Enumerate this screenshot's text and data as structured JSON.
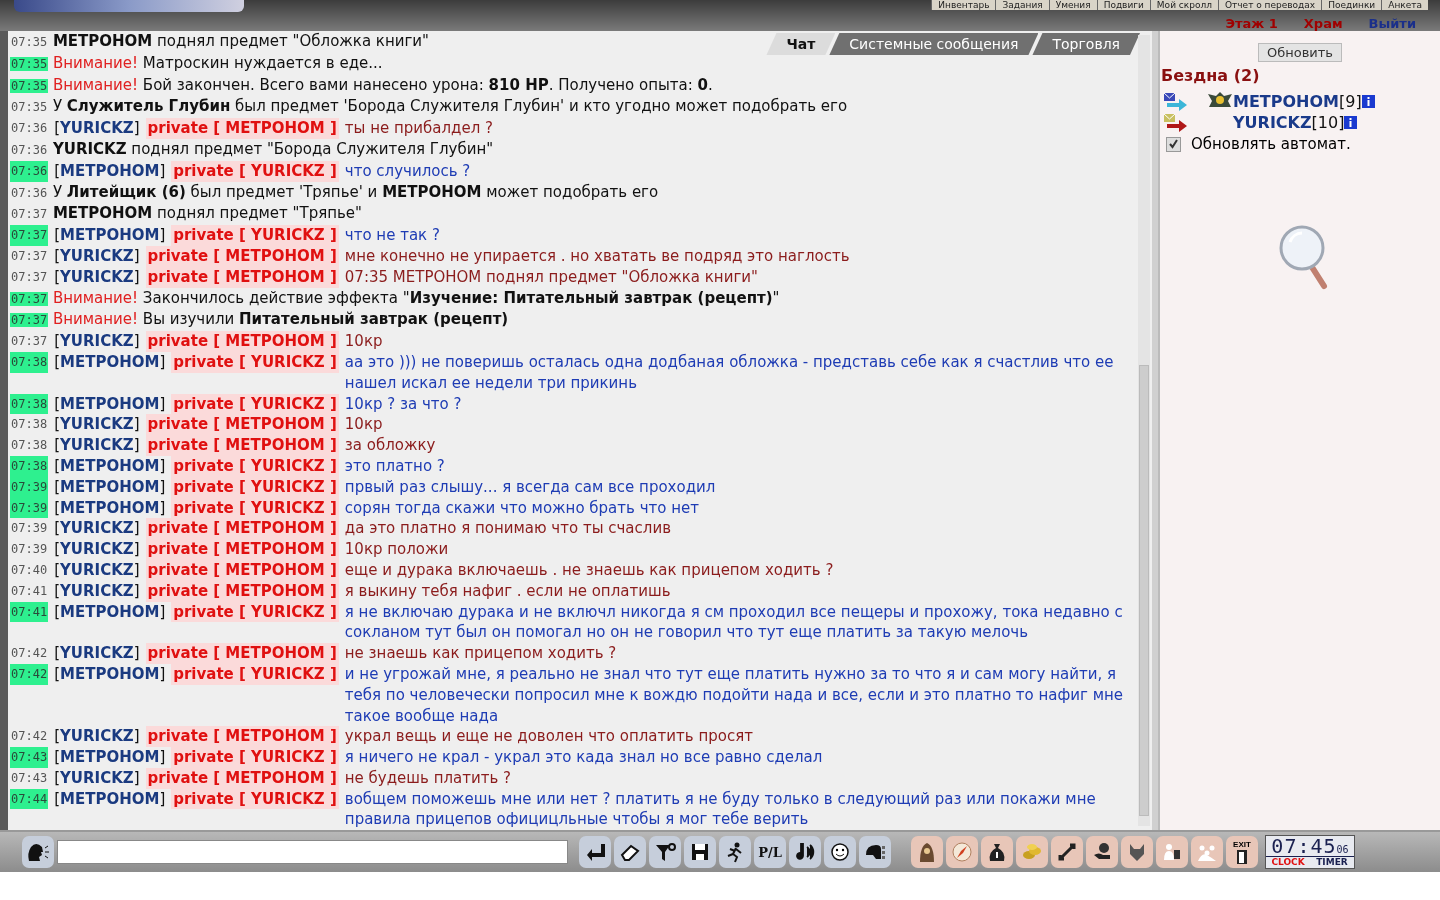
{
  "header": {
    "nav": [
      "Инвентарь",
      "Задания",
      "Умения",
      "Подвиги",
      "Мой скролл",
      "Отчет о переводах",
      "Поединки",
      "Анкета"
    ],
    "location": [
      {
        "text": "Этаж 1",
        "kind": "floor"
      },
      {
        "text": "Храм",
        "kind": "place"
      },
      {
        "text": "Выйти",
        "kind": "exit"
      }
    ]
  },
  "tabs": [
    {
      "label": "Чат",
      "selected": true
    },
    {
      "label": "Системные сообщения",
      "selected": false
    },
    {
      "label": "Торговля",
      "selected": false
    }
  ],
  "messages": [
    {
      "time": "07:35",
      "highlighted": false,
      "kind": "system",
      "text": "**МЕТРОНОМ** поднял предмет \"Обложка книги\""
    },
    {
      "time": "07:35",
      "highlighted": true,
      "kind": "warning",
      "label": "Внимание!",
      "text": "Матроскин нуждается в еде..."
    },
    {
      "time": "07:35",
      "highlighted": true,
      "kind": "warning",
      "label": "Внимание!",
      "text": "Бой закончен. Всего вами нанесено урона: **810 HP**. Получено опыта: **0**."
    },
    {
      "time": "07:35",
      "highlighted": false,
      "kind": "system",
      "text": "У **Служитель Глубин** был предмет 'Борода Служителя Глубин' и кто угодно может подобрать его"
    },
    {
      "time": "07:36",
      "highlighted": false,
      "kind": "private_in",
      "sender": "[**YURICKZ**]",
      "tag": "private [ МЕТРОНОМ ]",
      "text": "ты не прибалдел ?"
    },
    {
      "time": "07:36",
      "highlighted": false,
      "kind": "system",
      "text": "**YURICKZ** поднял предмет \"Борода Служителя Глубин\""
    },
    {
      "time": "07:36",
      "highlighted": true,
      "kind": "private_out",
      "sender": "[**МЕТРОНОМ**]",
      "tag": "private [ YURICKZ ]",
      "text": "что случилось ?"
    },
    {
      "time": "07:36",
      "highlighted": false,
      "kind": "system",
      "text": "У **Литейщик (6)** был предмет 'Тряпье' и **МЕТРОНОМ** может подобрать его"
    },
    {
      "time": "07:37",
      "highlighted": false,
      "kind": "system",
      "text": "**МЕТРОНОМ** поднял предмет \"Тряпье\""
    },
    {
      "time": "07:37",
      "highlighted": true,
      "kind": "private_out",
      "sender": "[**МЕТРОНОМ**]",
      "tag": "private [ YURICKZ ]",
      "text": "что не так ?"
    },
    {
      "time": "07:37",
      "highlighted": false,
      "kind": "private_in",
      "sender": "[**YURICKZ**]",
      "tag": "private [ МЕТРОНОМ ]",
      "text": "мне конечно не упирается . но хватать ве подряд это наглость"
    },
    {
      "time": "07:37",
      "highlighted": false,
      "kind": "private_in",
      "sender": "[**YURICKZ**]",
      "tag": "private [ МЕТРОНОМ ]",
      "text": "07:35 МЕТРОНОМ поднял предмет \"Обложка книги\""
    },
    {
      "time": "07:37",
      "highlighted": true,
      "kind": "warning",
      "label": "Внимание!",
      "text": "Закончилось действие эффекта \"**Изучение: Питательный завтрак (рецепт)**\""
    },
    {
      "time": "07:37",
      "highlighted": true,
      "kind": "warning",
      "label": "Внимание!",
      "text": "Вы изучили **Питательный завтрак (рецепт)**"
    },
    {
      "time": "07:37",
      "highlighted": false,
      "kind": "private_in",
      "sender": "[**YURICKZ**]",
      "tag": "private [ МЕТРОНОМ ]",
      "text": "10кр"
    },
    {
      "time": "07:38",
      "highlighted": true,
      "kind": "private_out",
      "sender": "[**МЕТРОНОМ**]",
      "tag": "private [ YURICKZ ]",
      "text": "аа это ))) не поверишь осталась одна додбаная обложка - представь себе как я счастлив что ее нашел искал ее недели три прикинь"
    },
    {
      "time": "07:38",
      "highlighted": true,
      "kind": "private_out",
      "sender": "[**МЕТРОНОМ**]",
      "tag": "private [ YURICKZ ]",
      "text": "10кр ? за что ?"
    },
    {
      "time": "07:38",
      "highlighted": false,
      "kind": "private_in",
      "sender": "[**YURICKZ**]",
      "tag": "private [ МЕТРОНОМ ]",
      "text": "10кр"
    },
    {
      "time": "07:38",
      "highlighted": false,
      "kind": "private_in",
      "sender": "[**YURICKZ**]",
      "tag": "private [ МЕТРОНОМ ]",
      "text": "за обложку"
    },
    {
      "time": "07:38",
      "highlighted": true,
      "kind": "private_out",
      "sender": "[**МЕТРОНОМ**]",
      "tag": "private [ YURICKZ ]",
      "text": "это платно ?"
    },
    {
      "time": "07:39",
      "highlighted": true,
      "kind": "private_out",
      "sender": "[**МЕТРОНОМ**]",
      "tag": "private [ YURICKZ ]",
      "text": "првый раз слышу... я всегда сам все проходил"
    },
    {
      "time": "07:39",
      "highlighted": true,
      "kind": "private_out",
      "sender": "[**МЕТРОНОМ**]",
      "tag": "private [ YURICKZ ]",
      "text": "сорян тогда скажи что можно брать что нет"
    },
    {
      "time": "07:39",
      "highlighted": false,
      "kind": "private_in",
      "sender": "[**YURICKZ**]",
      "tag": "private [ МЕТРОНОМ ]",
      "text": "да это платно я понимаю что ты счаслив"
    },
    {
      "time": "07:39",
      "highlighted": false,
      "kind": "private_in",
      "sender": "[**YURICKZ**]",
      "tag": "private [ МЕТРОНОМ ]",
      "text": "10кр положи"
    },
    {
      "time": "07:40",
      "highlighted": false,
      "kind": "private_in",
      "sender": "[**YURICKZ**]",
      "tag": "private [ МЕТРОНОМ ]",
      "text": "еще и дурака включаешь . не знаешь как прицепом ходить ?"
    },
    {
      "time": "07:41",
      "highlighted": false,
      "kind": "private_in",
      "sender": "[**YURICKZ**]",
      "tag": "private [ МЕТРОНОМ ]",
      "text": "я выкину тебя нафиг . если не оплатишь"
    },
    {
      "time": "07:41",
      "highlighted": true,
      "kind": "private_out",
      "sender": "[**МЕТРОНОМ**]",
      "tag": "private [ YURICKZ ]",
      "text": "я не включаю дурака и не включл никогда я см проходил все пещеры и прохожу, тока недавно с сокланом тут был он помогал но он не говорил что тут еще платить за такую мелочь"
    },
    {
      "time": "07:42",
      "highlighted": false,
      "kind": "private_in",
      "sender": "[**YURICKZ**]",
      "tag": "private [ МЕТРОНОМ ]",
      "text": "не знаешь как прицепом ходить ?"
    },
    {
      "time": "07:42",
      "highlighted": true,
      "kind": "private_out",
      "sender": "[**МЕТРОНОМ**]",
      "tag": "private [ YURICKZ ]",
      "text": "и не угрожай мне, я реально не знал что тут еще платить нужно за то что я и сам могу найти, я тебя по человечески попросил мне к вождю подойти нада и все, если и это платно то нафиг мне такое вообще нада"
    },
    {
      "time": "07:42",
      "highlighted": false,
      "kind": "private_in",
      "sender": "[**YURICKZ**]",
      "tag": "private [ МЕТРОНОМ ]",
      "text": "украл вещь и еще не доволен что оплатить просят"
    },
    {
      "time": "07:43",
      "highlighted": true,
      "kind": "private_out",
      "sender": "[**МЕТРОНОМ**]",
      "tag": "private [ YURICKZ ]",
      "text": "я ничего не крал - украл это када знал но все равно сделал"
    },
    {
      "time": "07:43",
      "highlighted": false,
      "kind": "private_in",
      "sender": "[**YURICKZ**]",
      "tag": "private [ МЕТРОНОМ ]",
      "text": "не будешь платить ?"
    },
    {
      "time": "07:44",
      "highlighted": true,
      "kind": "private_out",
      "sender": "[**МЕТРОНОМ**]",
      "tag": "private [ YURICKZ ]",
      "text": "вобщем поможешь мне или нет ? платить я не буду только в следующий раз или покажи мне правила прицепов официцльные чтобы я мог тебе верить"
    }
  ],
  "sidebar": {
    "refresh_button": "Обновить",
    "location": "Бездна (2)",
    "users": [
      {
        "name": "МЕТРОНОМ",
        "level": "[9]",
        "clan": true,
        "kind": "in"
      },
      {
        "name": "YURICKZ",
        "level": "[10]",
        "clan": false,
        "kind": "out"
      }
    ],
    "auto_refresh": {
      "label": "Обновлять автомат.",
      "checked": true
    }
  },
  "toolbar": {
    "pl_label": "P/L",
    "exit_label": "EXIT"
  },
  "clock": {
    "time": "07:45",
    "seconds": "06",
    "modes": [
      {
        "label": "CLOCK",
        "selected": true
      },
      {
        "label": "TIMER",
        "selected": false
      }
    ]
  }
}
